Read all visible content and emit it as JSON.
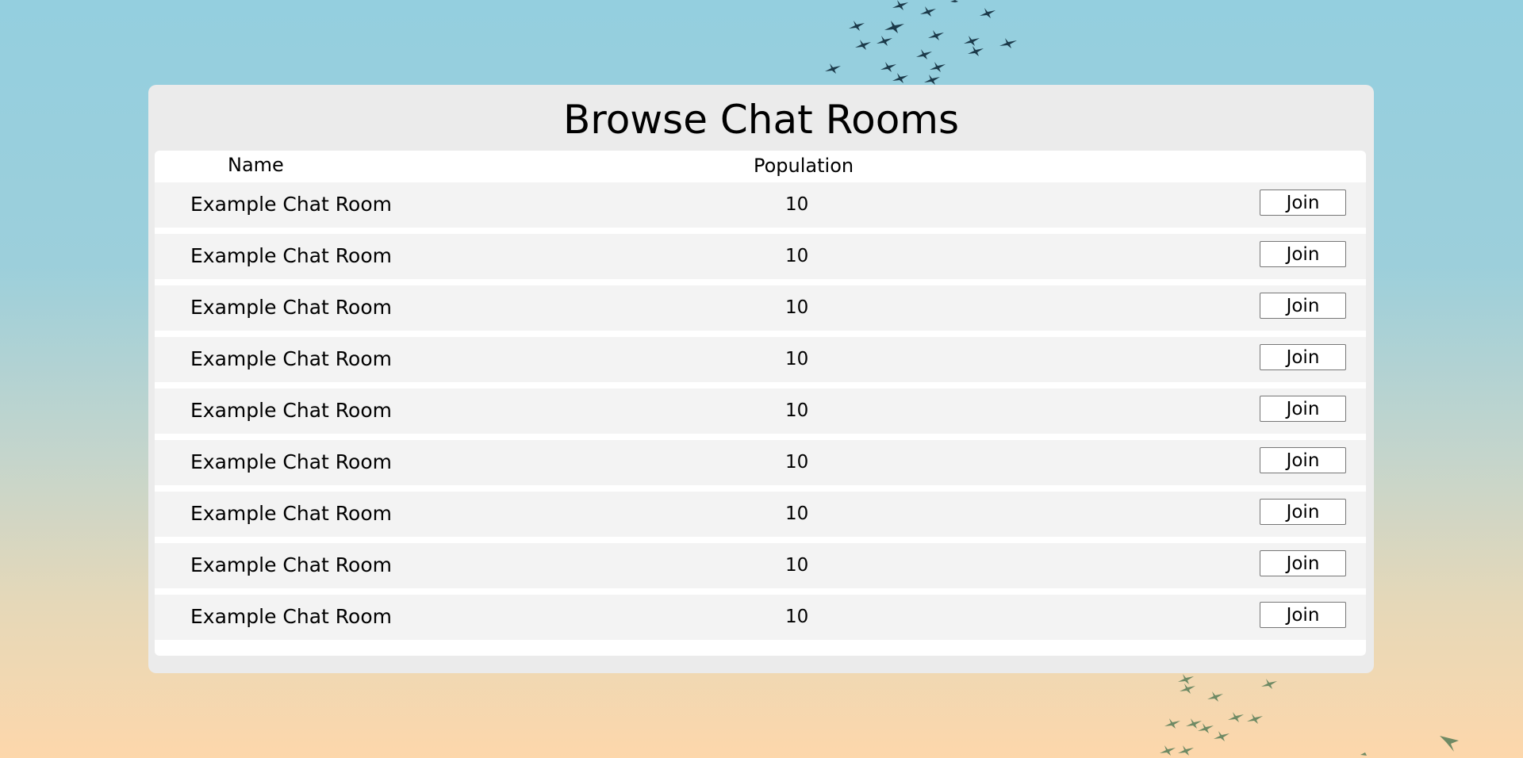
{
  "page": {
    "title": "Browse Chat Rooms"
  },
  "table": {
    "headers": {
      "name": "Name",
      "population": "Population"
    },
    "rows": [
      {
        "name": "Example Chat Room",
        "population": "10",
        "action": "Join"
      },
      {
        "name": "Example Chat Room",
        "population": "10",
        "action": "Join"
      },
      {
        "name": "Example Chat Room",
        "population": "10",
        "action": "Join"
      },
      {
        "name": "Example Chat Room",
        "population": "10",
        "action": "Join"
      },
      {
        "name": "Example Chat Room",
        "population": "10",
        "action": "Join"
      },
      {
        "name": "Example Chat Room",
        "population": "10",
        "action": "Join"
      },
      {
        "name": "Example Chat Room",
        "population": "10",
        "action": "Join"
      },
      {
        "name": "Example Chat Room",
        "population": "10",
        "action": "Join"
      },
      {
        "name": "Example Chat Room",
        "population": "10",
        "action": "Join"
      }
    ]
  },
  "background": {
    "icons": [
      "bird-flock-icon"
    ],
    "colors": {
      "sky_top": "#94cfdf",
      "sky_bottom": "#fdd7ab",
      "flock_dark": "#1c3a4a",
      "flock_green": "#6f8a64"
    }
  }
}
